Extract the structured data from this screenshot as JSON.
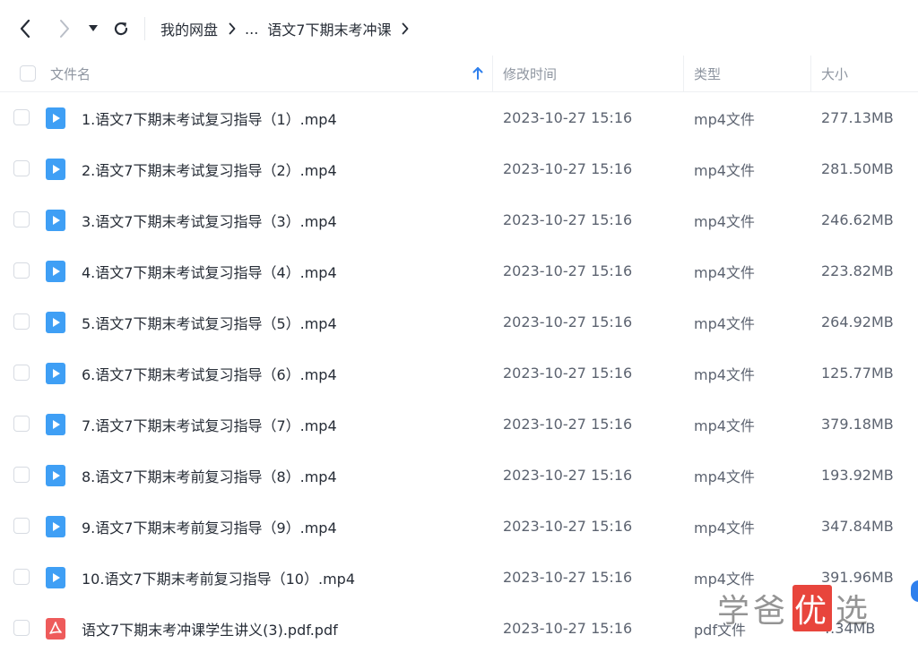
{
  "breadcrumb": {
    "root": "我的网盘",
    "ellipsis": "...",
    "current": "语文7下期末考冲课"
  },
  "header": {
    "name": "文件名",
    "modified": "修改时间",
    "type": "类型",
    "size": "大小",
    "sort_icon": "arrow-up-icon"
  },
  "files": [
    {
      "name": "1.语文7下期末考试复习指导（1）.mp4",
      "date": "2023-10-27 15:16",
      "type": "mp4文件",
      "size": "277.13MB",
      "icon": "video"
    },
    {
      "name": "2.语文7下期末考试复习指导（2）.mp4",
      "date": "2023-10-27 15:16",
      "type": "mp4文件",
      "size": "281.50MB",
      "icon": "video"
    },
    {
      "name": "3.语文7下期末考试复习指导（3）.mp4",
      "date": "2023-10-27 15:16",
      "type": "mp4文件",
      "size": "246.62MB",
      "icon": "video"
    },
    {
      "name": "4.语文7下期末考试复习指导（4）.mp4",
      "date": "2023-10-27 15:16",
      "type": "mp4文件",
      "size": "223.82MB",
      "icon": "video"
    },
    {
      "name": "5.语文7下期末考试复习指导（5）.mp4",
      "date": "2023-10-27 15:16",
      "type": "mp4文件",
      "size": "264.92MB",
      "icon": "video"
    },
    {
      "name": "6.语文7下期末考试复习指导（6）.mp4",
      "date": "2023-10-27 15:16",
      "type": "mp4文件",
      "size": "125.77MB",
      "icon": "video"
    },
    {
      "name": "7.语文7下期末考试复习指导（7）.mp4",
      "date": "2023-10-27 15:16",
      "type": "mp4文件",
      "size": "379.18MB",
      "icon": "video"
    },
    {
      "name": "8.语文7下期末考前复习指导（8）.mp4",
      "date": "2023-10-27 15:16",
      "type": "mp4文件",
      "size": "193.92MB",
      "icon": "video"
    },
    {
      "name": "9.语文7下期末考前复习指导（9）.mp4",
      "date": "2023-10-27 15:16",
      "type": "mp4文件",
      "size": "347.84MB",
      "icon": "video"
    },
    {
      "name": "10.语文7下期末考前复习指导（10）.mp4",
      "date": "2023-10-27 15:16",
      "type": "mp4文件",
      "size": "391.96MB",
      "icon": "video"
    },
    {
      "name": "语文7下期末考冲课学生讲义(3).pdf.pdf",
      "date": "2023-10-27 15:16",
      "type": "pdf文件",
      "size": "4.34MB",
      "icon": "pdf"
    }
  ],
  "watermark": {
    "part1": "学爸",
    "highlight": "优",
    "part2": "选"
  },
  "colors": {
    "video_icon": "#3f9ff5",
    "pdf_icon": "#ee5b5b",
    "sort_arrow": "#2f80ed"
  }
}
